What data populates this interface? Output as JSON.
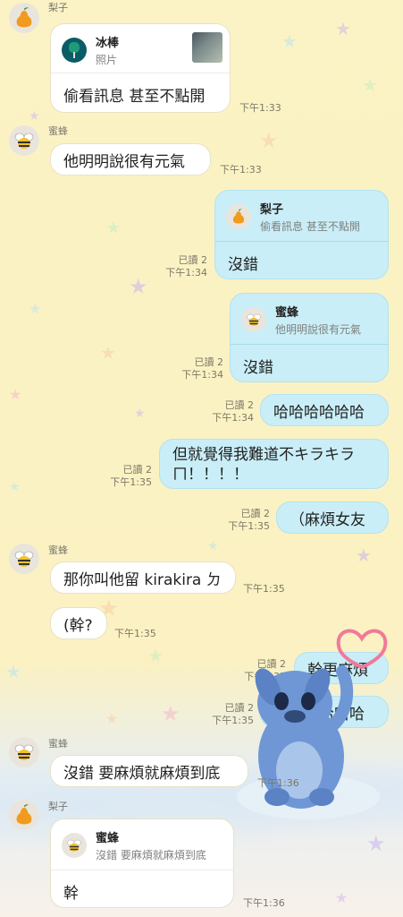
{
  "colors": {
    "background": "#fbf3c5",
    "incoming_bubble": "#ffffff",
    "outgoing_bubble": "#c9eef7",
    "time_text": "#7c7867"
  },
  "messages": [
    {
      "id": "m1",
      "sender": "梨子",
      "quote": {
        "name": "冰棒",
        "text": "照片"
      },
      "text": "偷看訊息 甚至不點開",
      "time": "下午1:33"
    },
    {
      "id": "m2",
      "sender": "蜜蜂",
      "text": "他明明說很有元氣",
      "time": "下午1:33"
    },
    {
      "id": "m3",
      "quote": {
        "name": "梨子",
        "text": "偷看訊息 甚至不點開"
      },
      "text": "沒錯",
      "read": "已讀 2",
      "time": "下午1:34"
    },
    {
      "id": "m4",
      "quote": {
        "name": "蜜蜂",
        "text": "他明明說很有元氣"
      },
      "text": "沒錯",
      "read": "已讀 2",
      "time": "下午1:34"
    },
    {
      "id": "m5",
      "text": "哈哈哈哈哈哈",
      "read": "已讀 2",
      "time": "下午1:34"
    },
    {
      "id": "m6",
      "text_line1": "但就覺得我難道不キラキラ",
      "text_line2": "ㄇ！！！！",
      "read": "已讀 2",
      "time": "下午1:35"
    },
    {
      "id": "m7",
      "text": "（麻煩女友",
      "read": "已讀 2",
      "time": "下午1:35"
    },
    {
      "id": "m8",
      "sender": "蜜蜂",
      "text": "那你叫他留 kirakira ㄉ",
      "time": "下午1:35"
    },
    {
      "id": "m9",
      "text": "(幹?",
      "time": "下午1:35"
    },
    {
      "id": "m10",
      "text": "幹更麻煩",
      "read": "已讀 2",
      "time": "下午1:35"
    },
    {
      "id": "m11",
      "text": "哈哈哈哈哈哈",
      "read": "已讀 2",
      "time": "下午1:35"
    },
    {
      "id": "m12",
      "sender": "蜜蜂",
      "text": "沒錯 要麻煩就麻煩到底",
      "time": "下午1:36"
    },
    {
      "id": "m13",
      "sender": "梨子",
      "quote": {
        "name": "蜜蜂",
        "text": "沒錯 要麻煩就麻煩到底"
      },
      "text": "幹",
      "time": "下午1:36"
    }
  ]
}
